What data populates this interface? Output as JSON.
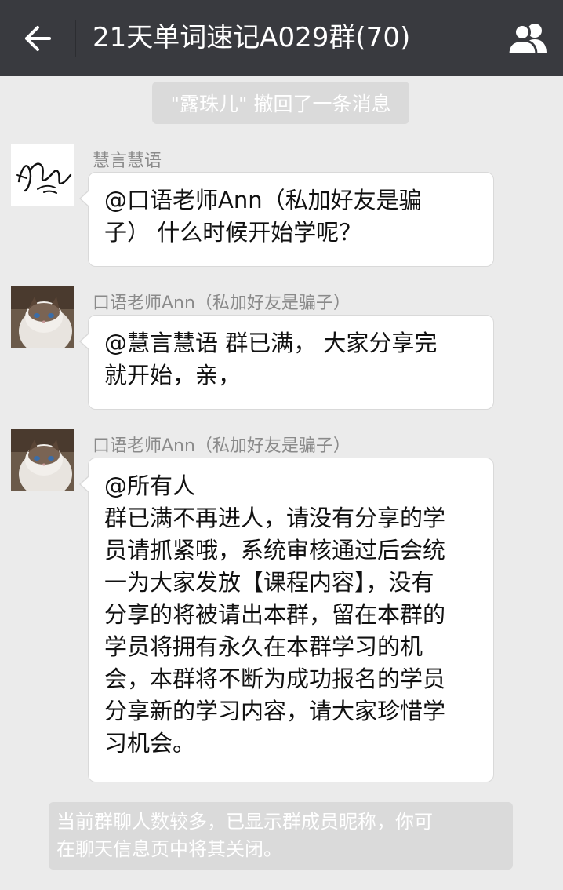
{
  "header": {
    "title": "21天单词速记A029群(70)",
    "back_icon": "arrow-left-icon",
    "members_icon": "group-members-icon"
  },
  "system_notice_top": "\"露珠儿\" 撤回了一条消息",
  "messages": [
    {
      "sender": "慧言慧语",
      "avatar": "signature-avatar",
      "lines": [
        "@口语老师Ann（私加好友是骗",
        "子） 什么时候开始学呢？"
      ]
    },
    {
      "sender": "口语老师Ann（私加好友是骗子）",
      "avatar": "cat-avatar",
      "lines": [
        "@慧言慧语   群已满， 大家分享完",
        "就开始，亲，"
      ]
    },
    {
      "sender": "口语老师Ann（私加好友是骗子）",
      "avatar": "cat-avatar",
      "lines": [
        "@所有人",
        "群已满不再进人，请没有分享的学",
        "员请抓紧哦，系统审核通过后会统",
        "一为大家发放【课程内容】，没有",
        "分享的将被请出本群，留在本群的",
        "学员将拥有永久在本群学习的机",
        "会，本群将不断为成功报名的学员",
        "分享新的学习内容，请大家珍惜学",
        "习机会。"
      ]
    }
  ],
  "system_notice_bottom": {
    "line1": "当前群聊人数较多，已显示群成员昵称，你可",
    "line2": "在聊天信息页中将其关闭。"
  },
  "colors": {
    "header_bg": "#393a3f",
    "chat_bg": "#ebebeb",
    "bubble_bg": "#ffffff",
    "notice_bg": "#dadada"
  }
}
